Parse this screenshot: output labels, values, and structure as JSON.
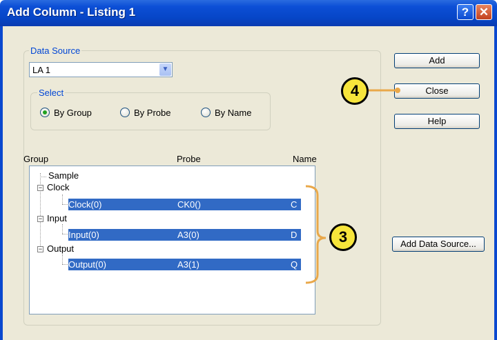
{
  "window": {
    "title": "Add Column - Listing 1",
    "help_glyph": "?",
    "close_glyph": "✕"
  },
  "data_source": {
    "label": "Data Source",
    "selected": "LA 1"
  },
  "select": {
    "label": "Select",
    "options": [
      {
        "label": "By Group",
        "checked": true
      },
      {
        "label": "By Probe",
        "checked": false
      },
      {
        "label": "By Name",
        "checked": false
      }
    ]
  },
  "columns": {
    "group": "Group",
    "probe": "Probe",
    "name": "Name"
  },
  "tree": {
    "sample": "Sample",
    "groups": [
      {
        "label": "Clock",
        "child": {
          "group": "Clock(0)",
          "probe": "CK0()",
          "name": "C"
        }
      },
      {
        "label": "Input",
        "child": {
          "group": "Input(0)",
          "probe": "A3(0)",
          "name": "D"
        }
      },
      {
        "label": "Output",
        "child": {
          "group": "Output(0)",
          "probe": "A3(1)",
          "name": "Q"
        }
      }
    ]
  },
  "buttons": {
    "add": "Add",
    "close": "Close",
    "help": "Help",
    "add_data_source": "Add Data Source..."
  },
  "callouts": {
    "step_close": "4",
    "step_tree": "3"
  },
  "colors": {
    "titlebar": "#0645c6",
    "selection": "#316ac5",
    "callout_fill": "#f7e53b",
    "callout_line": "#e9a84a",
    "radio_checked": "#21a121"
  }
}
